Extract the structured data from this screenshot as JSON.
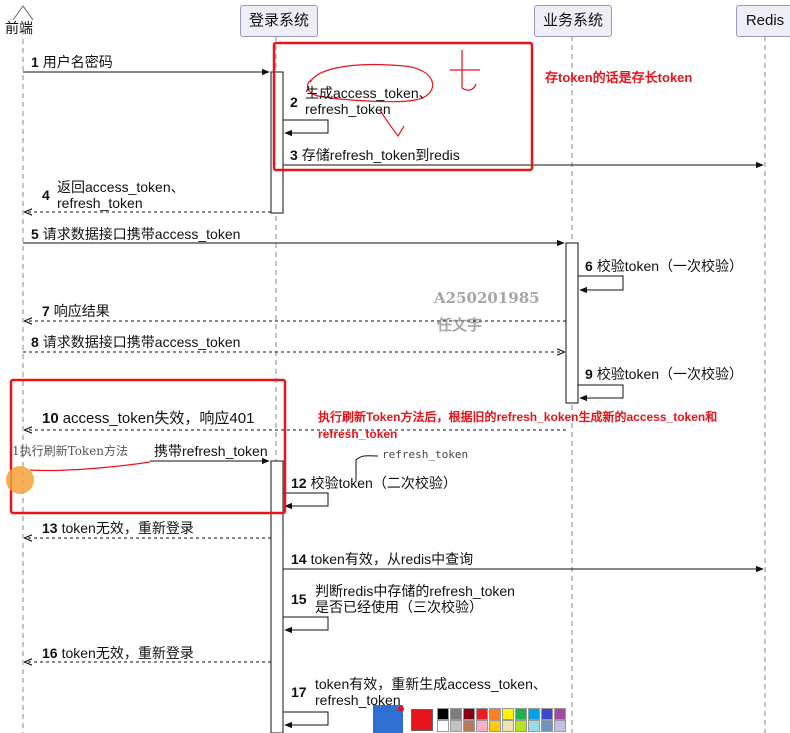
{
  "participants": {
    "frontend": "前端",
    "login": "登录系统",
    "business": "业务系统",
    "redis": "Redis"
  },
  "messages": [
    {
      "num": "1",
      "text": "用户名密码"
    },
    {
      "num": "2",
      "text1": "生成access_token、",
      "text2": "refresh_token"
    },
    {
      "num": "3",
      "text": "存储refresh_token到redis"
    },
    {
      "num": "4",
      "text1": "返回access_token、",
      "text2": "refresh_token"
    },
    {
      "num": "5",
      "text": "请求数据接口携带access_token"
    },
    {
      "num": "6",
      "text": "校验token（一次校验）"
    },
    {
      "num": "7",
      "text": "响应结果"
    },
    {
      "num": "8",
      "text": "请求数据接口携带access_token"
    },
    {
      "num": "9",
      "text": "校验token（一次校验）"
    },
    {
      "num": "10",
      "text": "access_token失效，响应401"
    },
    {
      "num": "11",
      "text": "携带refresh_token"
    },
    {
      "num": "12",
      "text": "校验token（二次校验）"
    },
    {
      "num": "13",
      "text": "token无效，重新登录"
    },
    {
      "num": "14",
      "text": "token有效，从redis中查询"
    },
    {
      "num": "15",
      "text1": "判断redis中存储的refresh_token",
      "text2": "是否已经使用（三次校验）"
    },
    {
      "num": "16",
      "text": "token无效，重新登录"
    },
    {
      "num": "17",
      "text1": "token有效，重新生成access_token、",
      "text2": "refresh_token"
    }
  ],
  "annotations": {
    "note_store_long": "存token的话是存长token",
    "note_refresh_line1": "执行刷新Token方法后，根据旧的refresh_koken生成新的access_token和",
    "note_refresh_line2": "refresh_token",
    "handwritten_11": "1执行刷新Token方法",
    "handwritten_refresh": "refresh_token"
  },
  "watermark": {
    "line1": "A250201985",
    "line2": "任文宇"
  },
  "colors": {
    "annotation_red": "#e8141b",
    "lifeline": "#8a8a8a",
    "header_bg": "#eeeef6",
    "header_border": "#9a9ab8"
  },
  "toolbar": {
    "selected_color_hex": "#e8141b",
    "palette_colors": [
      "#000000",
      "#7f7f7f",
      "#880015",
      "#ed1c24",
      "#ff7f27",
      "#fff200",
      "#22b14c",
      "#00a2e8",
      "#3f48cc",
      "#a349a4",
      "#ffffff",
      "#c3c3c3",
      "#b97a57",
      "#ffaec9",
      "#ffc90e",
      "#efe4b0",
      "#b5e61d",
      "#99d9ea",
      "#7092be",
      "#c8bfe7"
    ]
  }
}
